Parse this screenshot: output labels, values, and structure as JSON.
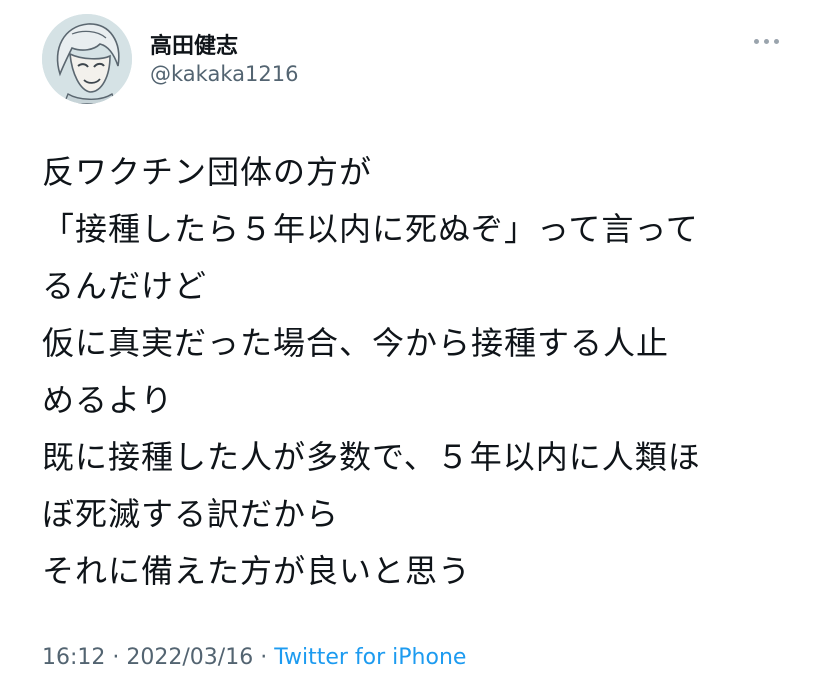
{
  "user": {
    "display_name": "高田健志",
    "handle": "@kakaka1216"
  },
  "tweet": {
    "lines": [
      "反ワクチン団体の方が",
      "「接種したら５年以内に死ぬぞ」って言って",
      "るんだけど",
      "仮に真実だった場合、今から接種する人止",
      "めるより",
      "既に接種した人が多数で、５年以内に人類ほ",
      "ぼ死滅する訳だから",
      "それに備えた方が良いと思う"
    ]
  },
  "meta": {
    "time": "16:12",
    "separator1": " · ",
    "date": "2022/03/16",
    "separator2": " · ",
    "source": "Twitter for iPhone"
  },
  "icons": {
    "avatar": "avatar-illustration",
    "more": "more-horizontal-icon"
  },
  "colors": {
    "text": "#0f1419",
    "secondary": "#536471",
    "link": "#1d9bf0"
  }
}
